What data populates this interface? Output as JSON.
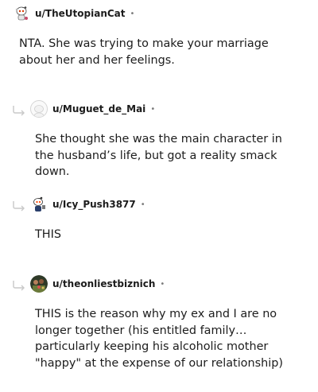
{
  "comments": [
    {
      "username": "u/TheUtopianCat",
      "separator": "•",
      "avatar_icon": "snoo-avatar-icon",
      "text": "NTA. She was trying to make your marriage about her and her feelings.",
      "is_reply": false
    },
    {
      "username": "u/Muguet_de_Mai",
      "separator": "•",
      "avatar_icon": "default-avatar-icon",
      "text": "She thought she was the main character in the husband’s life, but got a reality smack down.",
      "is_reply": true
    },
    {
      "username": "u/Icy_Push3877",
      "separator": "•",
      "avatar_icon": "snoo-avatar-icon",
      "text": "THIS",
      "is_reply": true
    },
    {
      "username": "u/theonliestbiznich",
      "separator": "•",
      "avatar_icon": "photo-avatar-icon",
      "text": "THIS is the reason why my ex and I are no longer together (his entitled family…particularly keeping his alcoholic mother \"happy\" at the expense of our relationship)",
      "is_reply": true
    }
  ],
  "colors": {
    "text": "#1c1c1c",
    "meta_dot": "#7c7c7c",
    "reply_line": "#c8c8c8"
  }
}
